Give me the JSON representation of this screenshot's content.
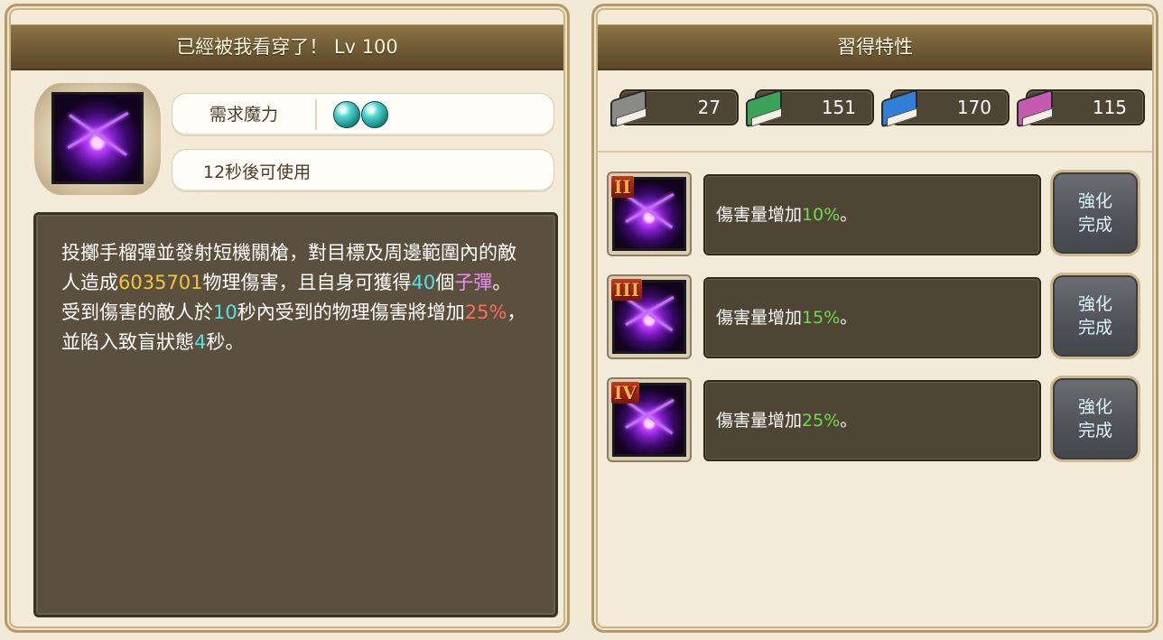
{
  "left_panel": {
    "title": "已經被我看穿了！ Lv 100",
    "skill_icon": "purple-energy-orb-icon",
    "mana": {
      "label": "需求魔力",
      "orb_count": 2,
      "orb_icon": "mana-orb-icon"
    },
    "cooldown_text": "12秒後可使用",
    "description": [
      {
        "t": "投擲手榴彈並發射短機關槍，對目標及周邊範圍內的敵人造成",
        "c": ""
      },
      {
        "t": "6035701",
        "c": "hl-gold"
      },
      {
        "t": "物理傷害，且自身可獲得",
        "c": ""
      },
      {
        "t": "40",
        "c": "hl-cyan"
      },
      {
        "t": "個",
        "c": ""
      },
      {
        "t": "子彈",
        "c": "hl-pink"
      },
      {
        "t": "。受到傷害的敵人於",
        "c": ""
      },
      {
        "t": "10",
        "c": "hl-cyan"
      },
      {
        "t": "秒內受到的物理傷害將增加",
        "c": ""
      },
      {
        "t": "25%",
        "c": "hl-red"
      },
      {
        "t": "，並陷入致盲狀態",
        "c": ""
      },
      {
        "t": "4",
        "c": "hl-cyan"
      },
      {
        "t": "秒。",
        "c": ""
      }
    ]
  },
  "right_panel": {
    "title": "習得特性",
    "books": [
      {
        "icon": "gray-book-icon",
        "count": "27",
        "color": "#8a8a86"
      },
      {
        "icon": "green-book-icon",
        "count": "151",
        "color": "#3aa35a"
      },
      {
        "icon": "blue-book-icon",
        "count": "170",
        "color": "#2f7fd6"
      },
      {
        "icon": "rainbow-book-icon",
        "count": "115",
        "color": "#c65ab0"
      }
    ],
    "traits": [
      {
        "rank": "II",
        "text": "傷害量增加",
        "pct": "10%",
        "suffix": "。",
        "button": "強化\n完成"
      },
      {
        "rank": "III",
        "text": "傷害量增加",
        "pct": "15%",
        "suffix": "。",
        "button": "強化\n完成"
      },
      {
        "rank": "IV",
        "text": "傷害量增加",
        "pct": "25%",
        "suffix": "。",
        "button": "強化\n完成"
      }
    ]
  }
}
